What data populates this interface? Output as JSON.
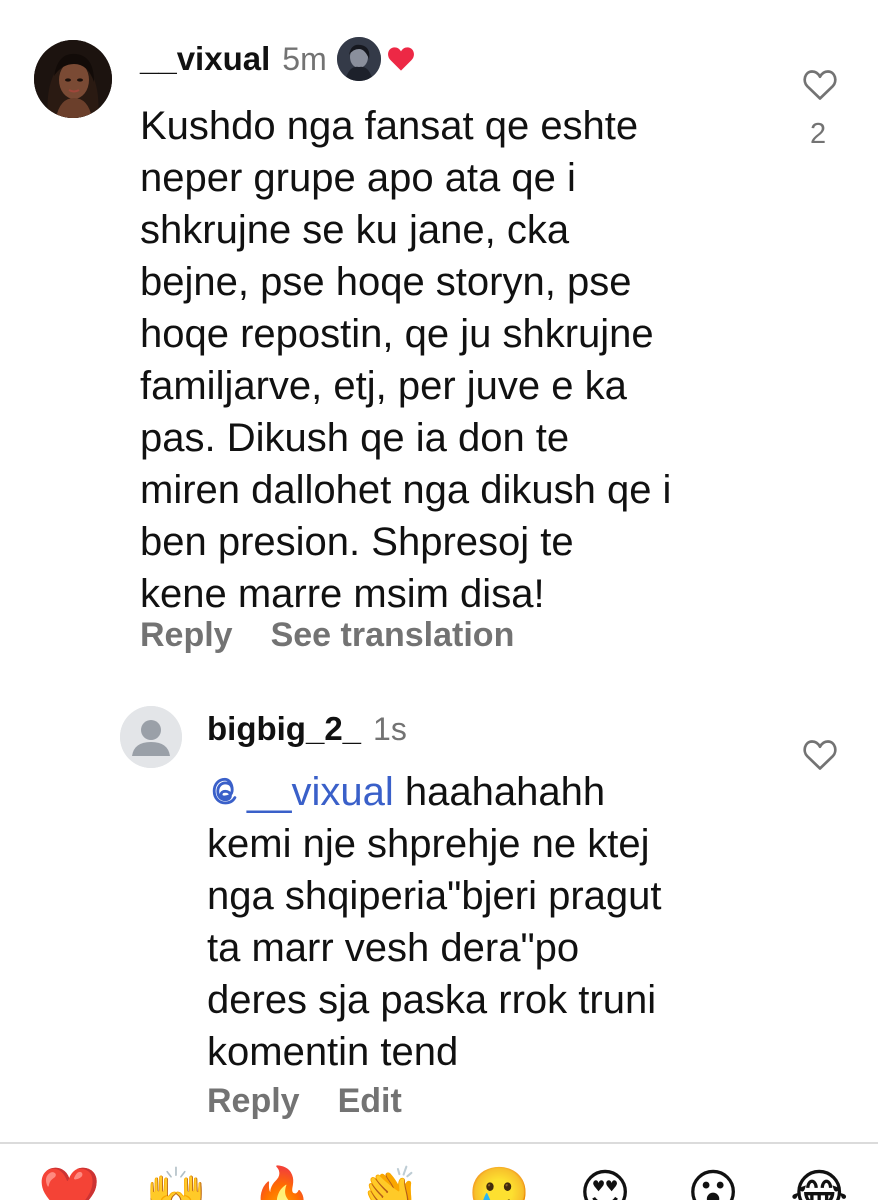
{
  "comment": {
    "username": "__vixual",
    "time": "5m",
    "text": "Kushdo nga fansat qe eshte\nneper grupe apo ata qe i\nshkrujne se ku jane, cka\nbejne, pse hoqe storyn, pse\nhoqe repostin, qe ju shkrujne\nfamiljarve, etj, per juve e ka\npas. Dikush qe ia don te\nmiren dallohet nga dikush qe i\nben presion. Shpresoj te\nkene marre msim disa!",
    "like_count": "2",
    "reply_label": "Reply",
    "translate_label": "See translation"
  },
  "reply": {
    "username": "bigbig_2_",
    "time": "1s",
    "mention": "__vixual",
    "text_first": " haahahahh",
    "text_rest": "kemi nje shprehje ne ktej\nnga shqiperia\"bjeri pragut\nta marr vesh dera\"po\nderes sja paska rrok truni\nkomentin tend",
    "reply_label": "Reply",
    "edit_label": "Edit"
  },
  "reactions": [
    "❤️",
    "🙌",
    "🔥",
    "👏",
    "🥲",
    "😍",
    "😮",
    "😂"
  ],
  "colors": {
    "accent_heart": "#ed2845",
    "mention": "#3a60c9",
    "muted": "#737373"
  }
}
